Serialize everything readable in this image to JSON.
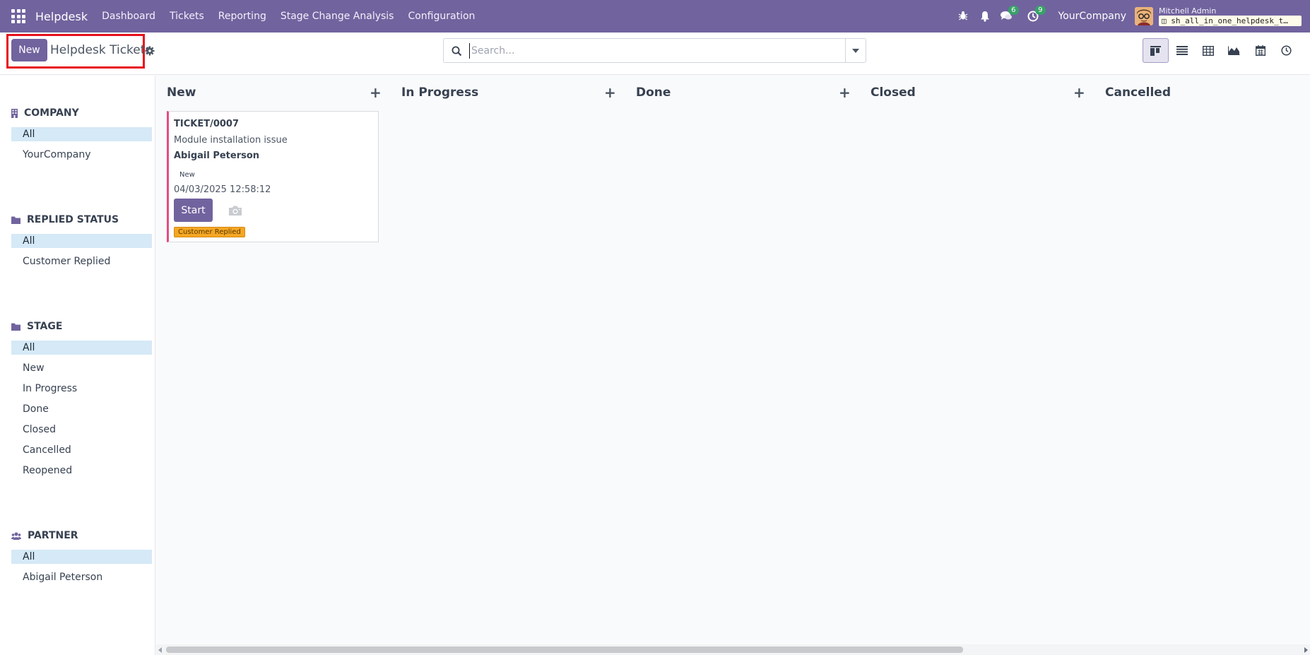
{
  "navbar": {
    "brand": "Helpdesk",
    "menu": [
      "Dashboard",
      "Tickets",
      "Reporting",
      "Stage Change Analysis",
      "Configuration"
    ],
    "messages_count": "6",
    "activities_count": "9",
    "company": "YourCompany",
    "user_name": "Mitchell Admin",
    "database": "sh_all_in_one_helpdesk_t…"
  },
  "control": {
    "new_label": "New",
    "title": "Helpdesk Tickets",
    "search_placeholder": "Search..."
  },
  "sidebar": {
    "company": {
      "heading": "COMPANY",
      "items": [
        "All",
        "YourCompany"
      ]
    },
    "replied": {
      "heading": "REPLIED STATUS",
      "items": [
        "All",
        "Customer Replied"
      ]
    },
    "stage": {
      "heading": "STAGE",
      "items": [
        "All",
        "New",
        "In Progress",
        "Done",
        "Closed",
        "Cancelled",
        "Reopened"
      ]
    },
    "partner": {
      "heading": "PARTNER",
      "items": [
        "All",
        "Abigail Peterson"
      ]
    }
  },
  "kanban": {
    "columns": [
      "New",
      "In Progress",
      "Done",
      "Closed",
      "Cancelled"
    ],
    "card": {
      "ref": "TICKET/0007",
      "subject": "Module installation issue",
      "partner": "Abigail Peterson",
      "stage": "New",
      "date": "04/03/2025 12:58:12",
      "start_label": "Start",
      "tag": "Customer Replied"
    }
  },
  "colors": {
    "brand": "#71639e",
    "active_filter": "#d5e9f7",
    "tag": "#f5a623",
    "card_border": "#e84a80"
  }
}
